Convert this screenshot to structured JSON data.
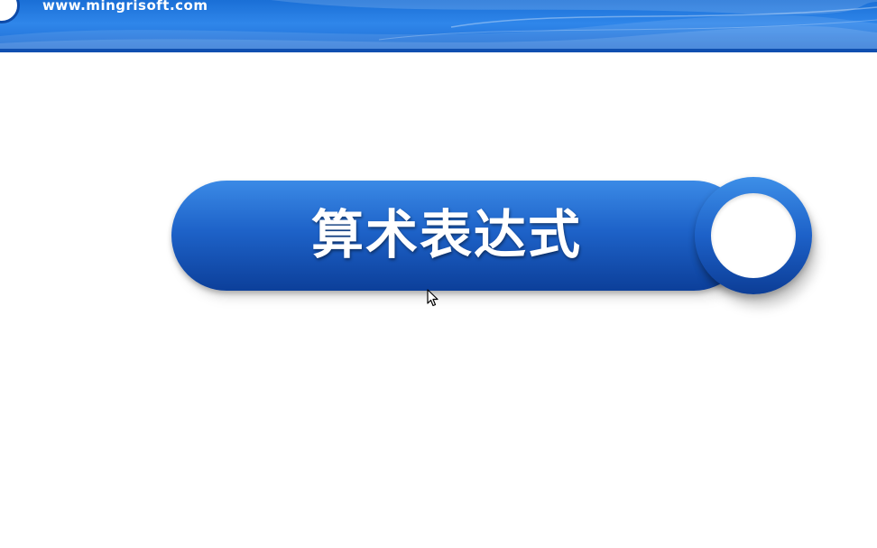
{
  "header": {
    "site_url": "www.mingrisoft.com",
    "colors": {
      "banner_primary": "#2f86ea",
      "banner_dark": "#0f4fb0"
    }
  },
  "slide": {
    "title": "算术表达式",
    "colors": {
      "pill_top": "#3b8ae6",
      "pill_bottom": "#0c3f9a",
      "title_text": "#ffffff",
      "knob_center": "#ffffff"
    }
  },
  "cursor": {
    "icon": "mouse-pointer-icon"
  }
}
